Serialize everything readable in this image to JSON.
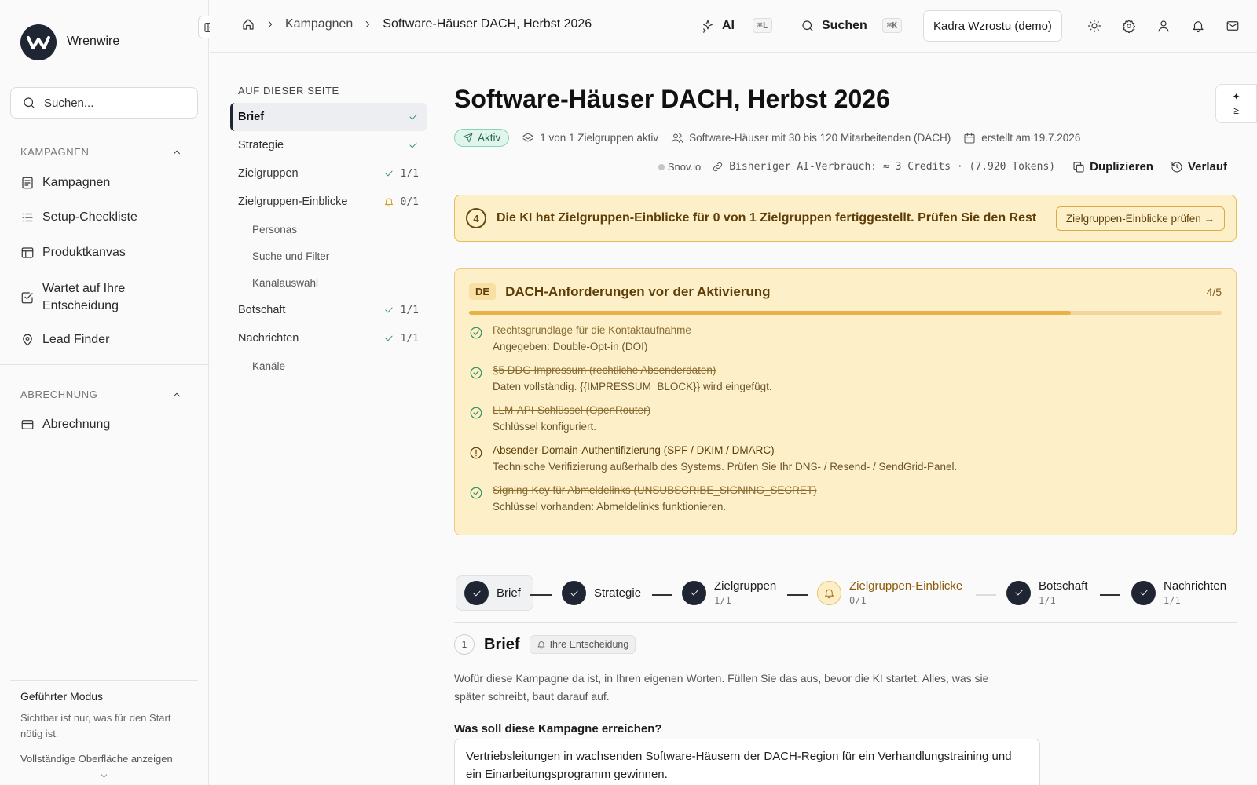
{
  "app": {
    "name": "Wrenwire"
  },
  "sidebar": {
    "search_placeholder": "Suchen...",
    "section_campaigns": "KAMPAGNEN",
    "items_campaigns": [
      {
        "label": "Kampagnen",
        "icon": "list-icon"
      },
      {
        "label": "Setup-Checkliste",
        "icon": "checklist-icon"
      },
      {
        "label": "Produktkanvas",
        "icon": "canvas-icon"
      },
      {
        "label": "Wartet auf Ihre Entscheidung",
        "icon": "check-square-icon"
      },
      {
        "label": "Lead Finder",
        "icon": "map-pin-icon"
      }
    ],
    "section_billing": "ABRECHNUNG",
    "items_billing": [
      {
        "label": "Abrechnung",
        "icon": "credit-card-icon"
      }
    ],
    "guided": {
      "title": "Geführter Modus",
      "desc": "Sichtbar ist nur, was für den Start nötig ist.",
      "link": "Vollständige Oberfläche anzeigen"
    }
  },
  "topbar": {
    "breadcrumb": [
      "Kampagnen",
      "Software-Häuser DACH, Herbst 2026"
    ],
    "ai_label": "AI",
    "ai_shortcut": "⌘L",
    "search_label": "Suchen",
    "search_shortcut": "⌘K",
    "workspace": "Kadra Wzrostu (demo)"
  },
  "on_this_page": {
    "heading": "AUF DIESER SEITE",
    "items": [
      {
        "label": "Brief",
        "status": "check",
        "count": ""
      },
      {
        "label": "Strategie",
        "status": "check",
        "count": ""
      },
      {
        "label": "Zielgruppen",
        "status": "check",
        "count": "1/1"
      },
      {
        "label": "Zielgruppen-Einblicke",
        "status": "bell",
        "count": "0/1"
      },
      {
        "label": "Personas",
        "sub": true
      },
      {
        "label": "Suche und Filter",
        "sub": true
      },
      {
        "label": "Kanalauswahl",
        "sub": true
      },
      {
        "label": "Botschaft",
        "status": "check",
        "count": "1/1"
      },
      {
        "label": "Nachrichten",
        "status": "check",
        "count": "1/1"
      },
      {
        "label": "Kanäle",
        "sub": true
      }
    ]
  },
  "page": {
    "title": "Software-Häuser DACH, Herbst 2026",
    "status_badge": "Aktiv",
    "groups_active": "1 von 1 Zielgruppen aktiv",
    "audience": "Software-Häuser mit 30 bis 120 Mitarbeitenden (DACH)",
    "created": "erstellt am 19.7.2026",
    "provider": "Snov.io",
    "ai_usage": "Bisheriger AI-Verbrauch: ≈ 3 Credits · (7.920 Tokens)",
    "duplicate_label": "Duplizieren",
    "history_label": "Verlauf"
  },
  "alert": {
    "number": "4",
    "text": "Die KI hat Zielgruppen-Einblicke für 0 von 1 Zielgruppen fertiggestellt. Prüfen Sie den Rest",
    "button": "Zielgruppen-Einblicke prüfen →"
  },
  "requirements": {
    "tag": "DE",
    "title": "DACH-Anforderungen vor der Aktivierung",
    "count": "4/5",
    "progress": 0.8,
    "items": [
      {
        "title": "Rechtsgrundlage für die Kontaktaufnahme",
        "detail": "Angegeben: Double-Opt-in (DOI)",
        "done": true
      },
      {
        "title": "§5 DDG Impressum (rechtliche Absenderdaten)",
        "detail": "Daten vollständig. {{IMPRESSUM_BLOCK}} wird eingefügt.",
        "done": true
      },
      {
        "title": "LLM-API-Schlüssel (OpenRouter)",
        "detail": "Schlüssel konfiguriert.",
        "done": true
      },
      {
        "title": "Absender-Domain-Authentifizierung (SPF / DKIM / DMARC)",
        "detail": "Technische Verifizierung außerhalb des Systems. Prüfen Sie Ihr DNS- / Resend- / SendGrid-Panel.",
        "done": false
      },
      {
        "title": "Signing-Key für Abmeldelinks (UNSUBSCRIBE_SIGNING_SECRET)",
        "detail": "Schlüssel vorhanden: Abmeldelinks funktionieren.",
        "done": true
      }
    ]
  },
  "stepper": [
    {
      "label": "Brief",
      "sub": ""
    },
    {
      "label": "Strategie",
      "sub": ""
    },
    {
      "label": "Zielgruppen",
      "sub": "1/1"
    },
    {
      "label": "Zielgruppen-Einblicke",
      "sub": "0/1"
    },
    {
      "label": "Botschaft",
      "sub": "1/1"
    },
    {
      "label": "Nachrichten",
      "sub": "1/1"
    }
  ],
  "brief": {
    "number": "1",
    "title": "Brief",
    "decision_tag": "Ihre Entscheidung",
    "description": "Wofür diese Kampagne da ist, in Ihren eigenen Worten. Füllen Sie das aus, bevor die KI startet: Alles, was sie später schreibt, baut darauf auf.",
    "question": "Was soll diese Kampagne erreichen?",
    "answer": "Vertriebsleitungen in wachsenden Software-Häusern der DACH-Region für ein Verhandlungstraining und ein Einarbeitungsprogramm gewinnen."
  },
  "colors": {
    "accent": "#1f2533",
    "warning_bg": "#fdf0c8",
    "success": "#2f8f63"
  }
}
